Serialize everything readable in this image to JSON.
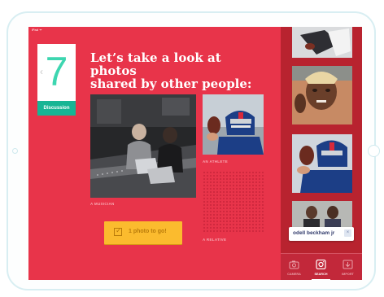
{
  "status_bar": {
    "left": "iPad ᯤ",
    "right": "▬"
  },
  "card": {
    "number": "7",
    "label": "Discussion",
    "chevron": "‹"
  },
  "title": {
    "line1": "Let’s take a look at photos",
    "line2": "shared by other people:"
  },
  "photos": [
    {
      "caption": "A MUSICIAN",
      "subject": "two men at a music studio mixing desk with laptops"
    },
    {
      "caption": "AN ATHLETE",
      "subject": "football player in blue helmet reaching for ball"
    },
    {
      "caption": "A RELATIVE",
      "subject": "empty placeholder"
    }
  ],
  "cta": {
    "label": "1 photo to go!",
    "icon": "checkbox-icon"
  },
  "sidebar": {
    "search_suggestion": "odell beckham jr",
    "close_icon": "×",
    "tiles": [
      "football catch",
      "man selfie",
      "football helmet catch",
      "two men portrait"
    ]
  },
  "tabs": [
    {
      "label": "CAMERA",
      "icon": "camera-icon",
      "active": false
    },
    {
      "label": "SEARCH",
      "icon": "instagram-icon",
      "active": true
    },
    {
      "label": "IMPORT",
      "icon": "import-icon",
      "active": false
    }
  ],
  "colors": {
    "background": "#e8344a",
    "sidebar": "#b8232f",
    "accent": "#17b594",
    "cta": "#fbbb2e"
  }
}
